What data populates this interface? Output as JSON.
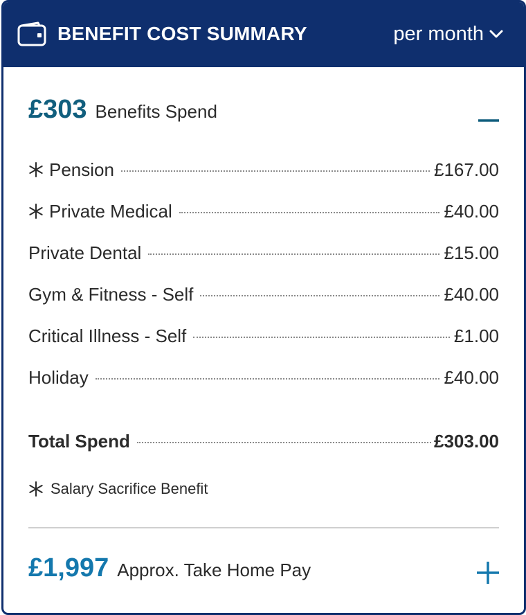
{
  "header": {
    "title": "BENEFIT COST SUMMARY",
    "period": "per month",
    "icon": "wallet-icon"
  },
  "summary": {
    "amount": "£303",
    "label": "Benefits Spend",
    "toggle_icon": "minus-icon"
  },
  "items": [
    {
      "name": "Pension",
      "amount": "£167.00",
      "salary_sacrifice": true
    },
    {
      "name": "Private Medical",
      "amount": "£40.00",
      "salary_sacrifice": true
    },
    {
      "name": "Private Dental",
      "amount": "£15.00",
      "salary_sacrifice": false
    },
    {
      "name": "Gym & Fitness - Self",
      "amount": "£40.00",
      "salary_sacrifice": false
    },
    {
      "name": "Critical Illness - Self",
      "amount": "£1.00",
      "salary_sacrifice": false
    },
    {
      "name": "Holiday",
      "amount": "£40.00",
      "salary_sacrifice": false
    }
  ],
  "total": {
    "label": "Total Spend",
    "amount": "£303.00"
  },
  "footnote": "Salary Sacrifice Benefit",
  "take_home": {
    "amount": "£1,997",
    "label": "Approx. Take Home Pay",
    "toggle_icon": "plus-icon"
  },
  "colors": {
    "header_bg": "#0f2f6e",
    "accent_teal": "#115f7e",
    "accent_blue": "#1478ad"
  }
}
